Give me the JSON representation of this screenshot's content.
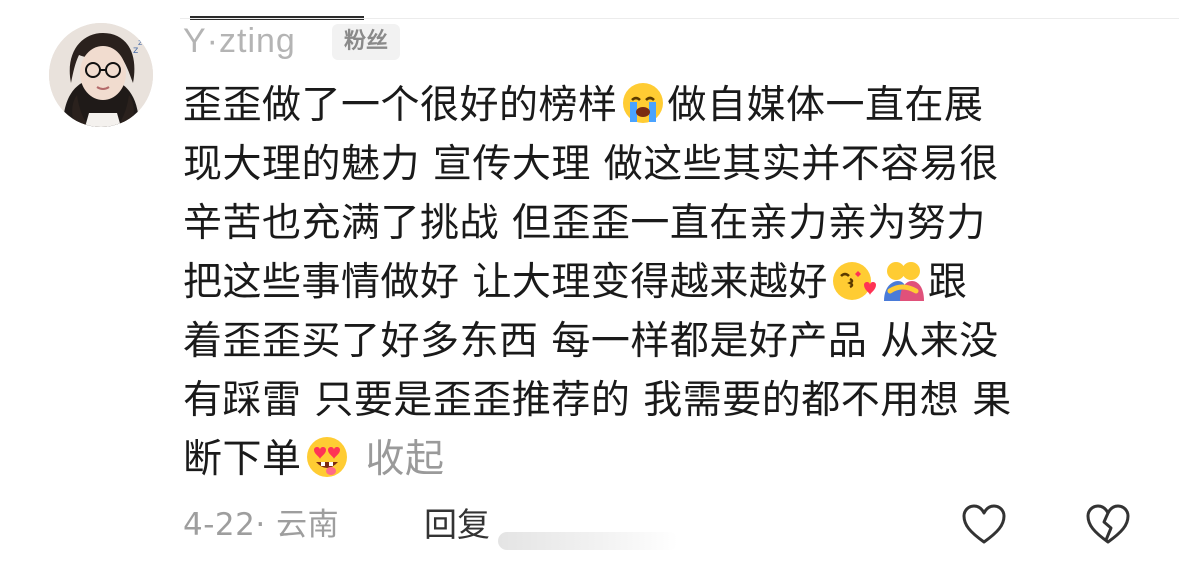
{
  "comment": {
    "username": "Y·zting",
    "badge": "粉丝",
    "avatar_icon": "avatar-photo",
    "lines": [
      {
        "parts": [
          {
            "type": "text",
            "value": "歪歪做了一个很好的榜样"
          },
          {
            "type": "emoji",
            "value": "loudly-crying-face"
          },
          {
            "type": "text",
            "value": "做自媒体一直在展"
          }
        ]
      },
      {
        "parts": [
          {
            "type": "text",
            "value": "现大理的魅力 宣传大理 做这些其实并不容易很"
          }
        ]
      },
      {
        "parts": [
          {
            "type": "text",
            "value": "辛苦也充满了挑战 但歪歪一直在亲力亲为努力"
          }
        ]
      },
      {
        "parts": [
          {
            "type": "text",
            "value": "把这些事情做好 让大理变得越来越好"
          },
          {
            "type": "emoji",
            "value": "face-blowing-kiss"
          },
          {
            "type": "emoji",
            "value": "people-hugging"
          },
          {
            "type": "text",
            "value": "跟"
          }
        ]
      },
      {
        "parts": [
          {
            "type": "text",
            "value": "着歪歪买了好多东西 每一样都是好产品 从来没"
          }
        ]
      },
      {
        "parts": [
          {
            "type": "text",
            "value": "有踩雷 只要是歪歪推荐的 我需要的都不用想 果"
          }
        ]
      },
      {
        "parts": [
          {
            "type": "text",
            "value": "断下单"
          },
          {
            "type": "emoji",
            "value": "heart-eyes-tongue-face"
          }
        ]
      }
    ],
    "collapse_label": "收起",
    "date": "4-22·",
    "location": "云南",
    "reply_label": "回复",
    "like_icon": "heart-outline-icon",
    "dislike_icon": "broken-heart-icon"
  }
}
